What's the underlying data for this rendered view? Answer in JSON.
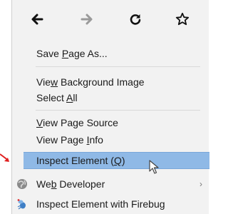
{
  "menu": {
    "items": [
      {
        "pre": "Save ",
        "u": "P",
        "post": "age As..."
      },
      {
        "pre": "Vie",
        "u": "w",
        "post": " Background Image"
      },
      {
        "pre": "Select ",
        "u": "A",
        "post": "ll"
      },
      {
        "pre": "",
        "u": "V",
        "post": "iew Page Source"
      },
      {
        "pre": "View Page ",
        "u": "I",
        "post": "nfo"
      },
      {
        "pre": "Inspect Element (",
        "u": "Q",
        "post": ")"
      },
      {
        "pre": "We",
        "u": "b",
        "post": " Developer"
      },
      {
        "pre": "Inspect Element with Firebug",
        "u": "",
        "post": ""
      }
    ],
    "submenu_chevron": "›"
  },
  "colors": {
    "highlight": "#8fb9e6",
    "menu_bg": "#f2f2f2",
    "annotation": "#e02020"
  },
  "icons": {
    "back": "arrow-left-icon",
    "forward": "arrow-right-icon",
    "reload": "reload-icon",
    "bookmark": "star-icon",
    "web_developer": "globe-icon",
    "firebug": "firebug-icon",
    "annotation": "red-arrow-icon",
    "cursor": "mouse-cursor-icon"
  }
}
